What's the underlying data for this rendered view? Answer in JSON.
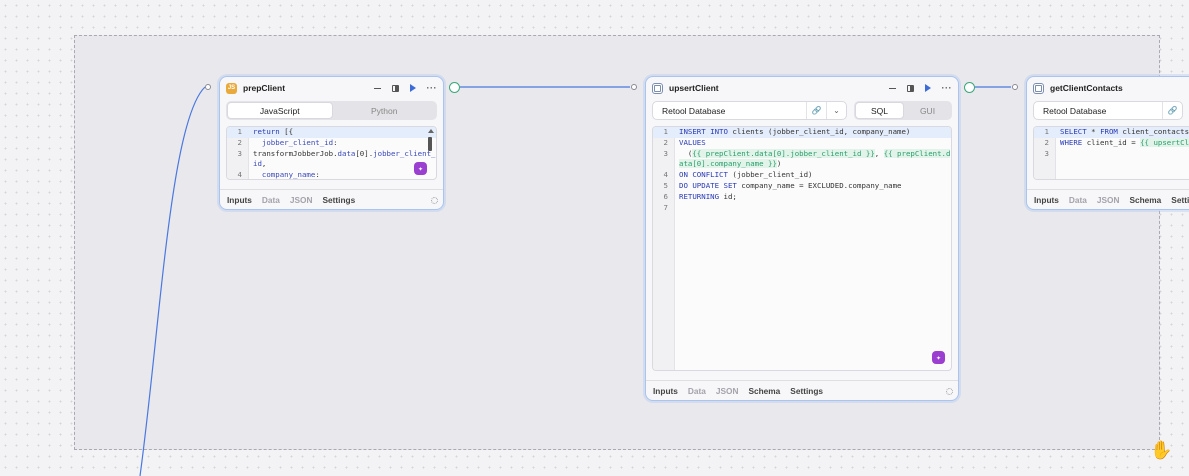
{
  "canvas": {
    "blocks": [
      {
        "id": "prepClient",
        "title": "prepClient",
        "type_icon": "js-icon",
        "type_icon_text": "JS",
        "language_tabs": [
          "JavaScript",
          "Python"
        ],
        "selected_language": "JavaScript",
        "code_lines": [
          {
            "n": "1",
            "text": "return [{"
          },
          {
            "n": "2",
            "text": "  jobber_client_id:"
          },
          {
            "n": "",
            "text": "transformJobberJob.data[0].jobber_client_id,"
          },
          {
            "n": "3",
            "text": ""
          },
          {
            "n": "4",
            "text": "  company_name:"
          }
        ],
        "footer_tabs": [
          "Inputs",
          "Data",
          "JSON",
          "Settings"
        ]
      },
      {
        "id": "upsertClient",
        "title": "upsertClient",
        "type_icon": "database-icon",
        "resource": "Retool Database",
        "mode_tabs": [
          "SQL",
          "GUI"
        ],
        "selected_mode": "SQL",
        "code_lines": [
          {
            "n": "1",
            "text": "INSERT INTO clients (jobber_client_id, company_name)"
          },
          {
            "n": "2",
            "text": "VALUES"
          },
          {
            "n": "3",
            "text": "  ({{ prepClient.data[0].jobber_client_id }}, {{ prepClient.data[0].company_name }})"
          },
          {
            "n": "4",
            "text": "ON CONFLICT (jobber_client_id)"
          },
          {
            "n": "5",
            "text": "DO UPDATE SET company_name = EXCLUDED.company_name"
          },
          {
            "n": "6",
            "text": "RETURNING id;"
          },
          {
            "n": "7",
            "text": ""
          }
        ],
        "footer_tabs": [
          "Inputs",
          "Data",
          "JSON",
          "Schema",
          "Settings"
        ]
      },
      {
        "id": "getClientContacts",
        "title": "getClientContacts",
        "type_icon": "database-icon",
        "resource": "Retool Database",
        "code_lines": [
          {
            "n": "1",
            "text": "SELECT * FROM client_contacts"
          },
          {
            "n": "2",
            "text": "WHERE client_id = {{ upsertCl"
          },
          {
            "n": "3",
            "text": ""
          }
        ],
        "footer_tabs": [
          "Inputs",
          "Data",
          "JSON",
          "Schema",
          "Settin"
        ]
      }
    ]
  },
  "colors": {
    "block_border": "#a9c4ef",
    "wire_left": "#4a78e0",
    "wire_success": "#39a87a",
    "play": "#3d6bd8",
    "ai_button": "#9b3fd1"
  }
}
